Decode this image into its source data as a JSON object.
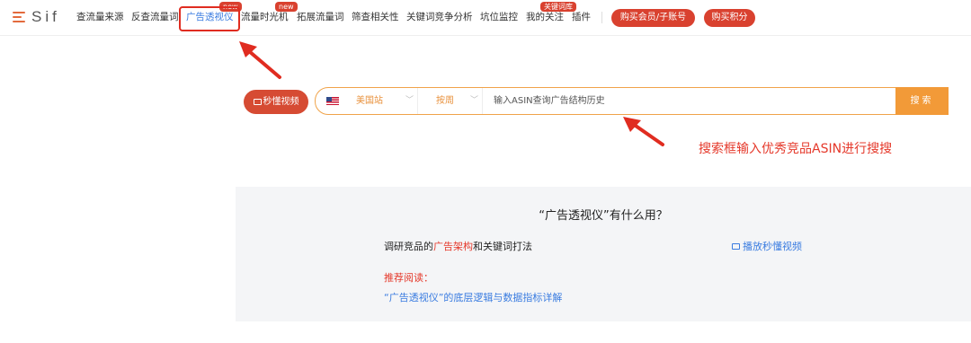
{
  "header": {
    "logo_text": "Sif",
    "nav": [
      {
        "label": "查流量来源"
      },
      {
        "label": "反查流量词"
      },
      {
        "label": "广告透视仪",
        "badge": "new",
        "active": true
      },
      {
        "label": "流量时光机",
        "badge": "new"
      },
      {
        "label": "拓展流量词"
      },
      {
        "label": "筛查相关性"
      },
      {
        "label": "关键词竞争分析"
      },
      {
        "label": "坑位监控"
      },
      {
        "label": "我的关注",
        "badge": "关键词库"
      },
      {
        "label": "插件"
      }
    ],
    "buy_member_label": "购买会员/子账号",
    "buy_points_label": "购买积分"
  },
  "search": {
    "video_button_label": "秒懂视频",
    "site_label": "美国站",
    "period_label": "按周",
    "placeholder": "输入ASIN查询广告结构历史",
    "button_label": "搜索"
  },
  "annotation": {
    "callout_text": "搜索框输入优秀竞品ASIN进行搜搜",
    "color": "#e5392b"
  },
  "info": {
    "title": "“广告透视仪”有什么用？",
    "line_prefix": "调研竞品的",
    "line_highlight": "广告架构",
    "line_suffix": "和关键词打法",
    "video_link": "播放秒懂视频",
    "recommend_label": "推荐阅读：",
    "article_link": "“广告透视仪”的底层逻辑与数据指标详解"
  },
  "colors": {
    "brand_red": "#d9412f",
    "accent_orange": "#f29a38",
    "link_blue": "#3a7ce0"
  }
}
